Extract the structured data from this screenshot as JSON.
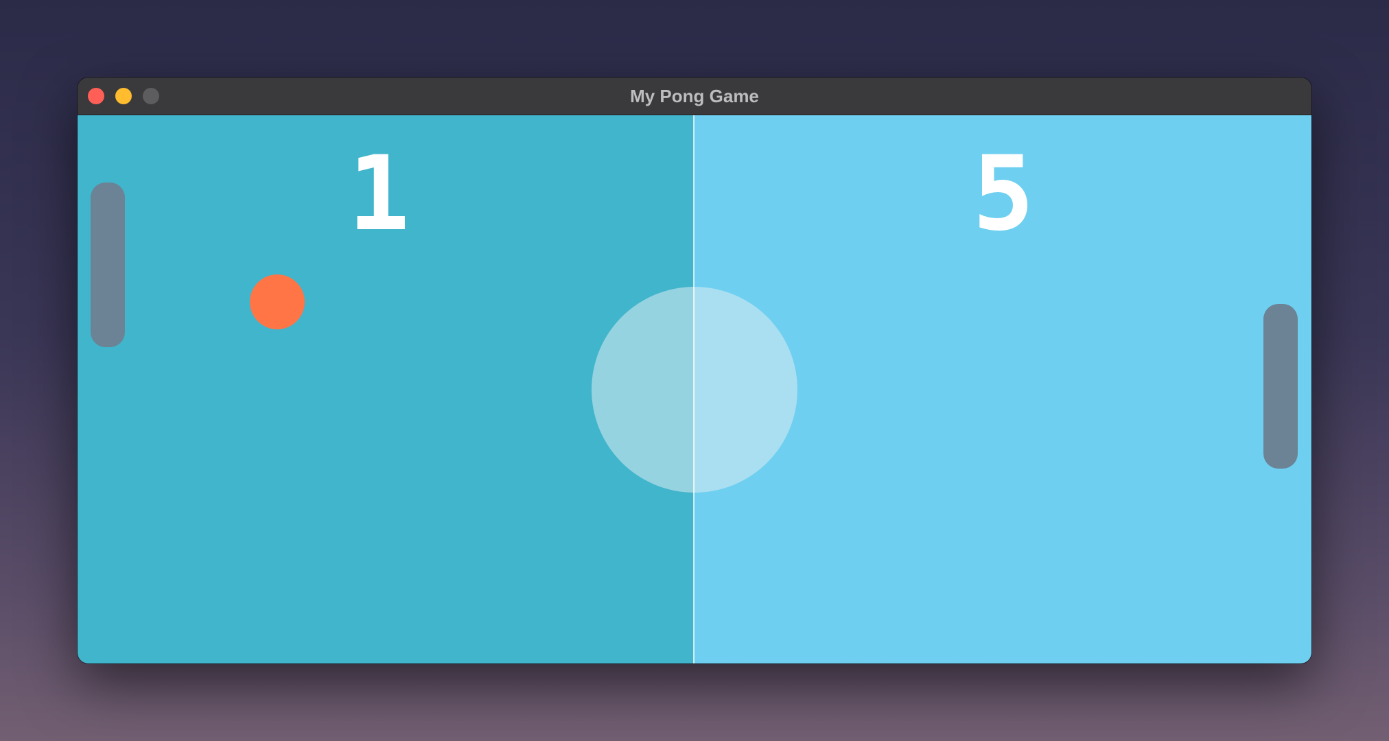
{
  "window": {
    "title": "My Pong Game"
  },
  "scores": {
    "left": "1",
    "right": "5"
  },
  "colors": {
    "left_court": "#41b5cb",
    "right_court": "#6ecff0",
    "paddle": "#6c8295",
    "ball": "#ff7545",
    "score_text": "#ffffff"
  },
  "icons": {
    "close": "close-button-red",
    "minimize": "minimize-button-yellow",
    "maximize": "maximize-button-gray"
  }
}
